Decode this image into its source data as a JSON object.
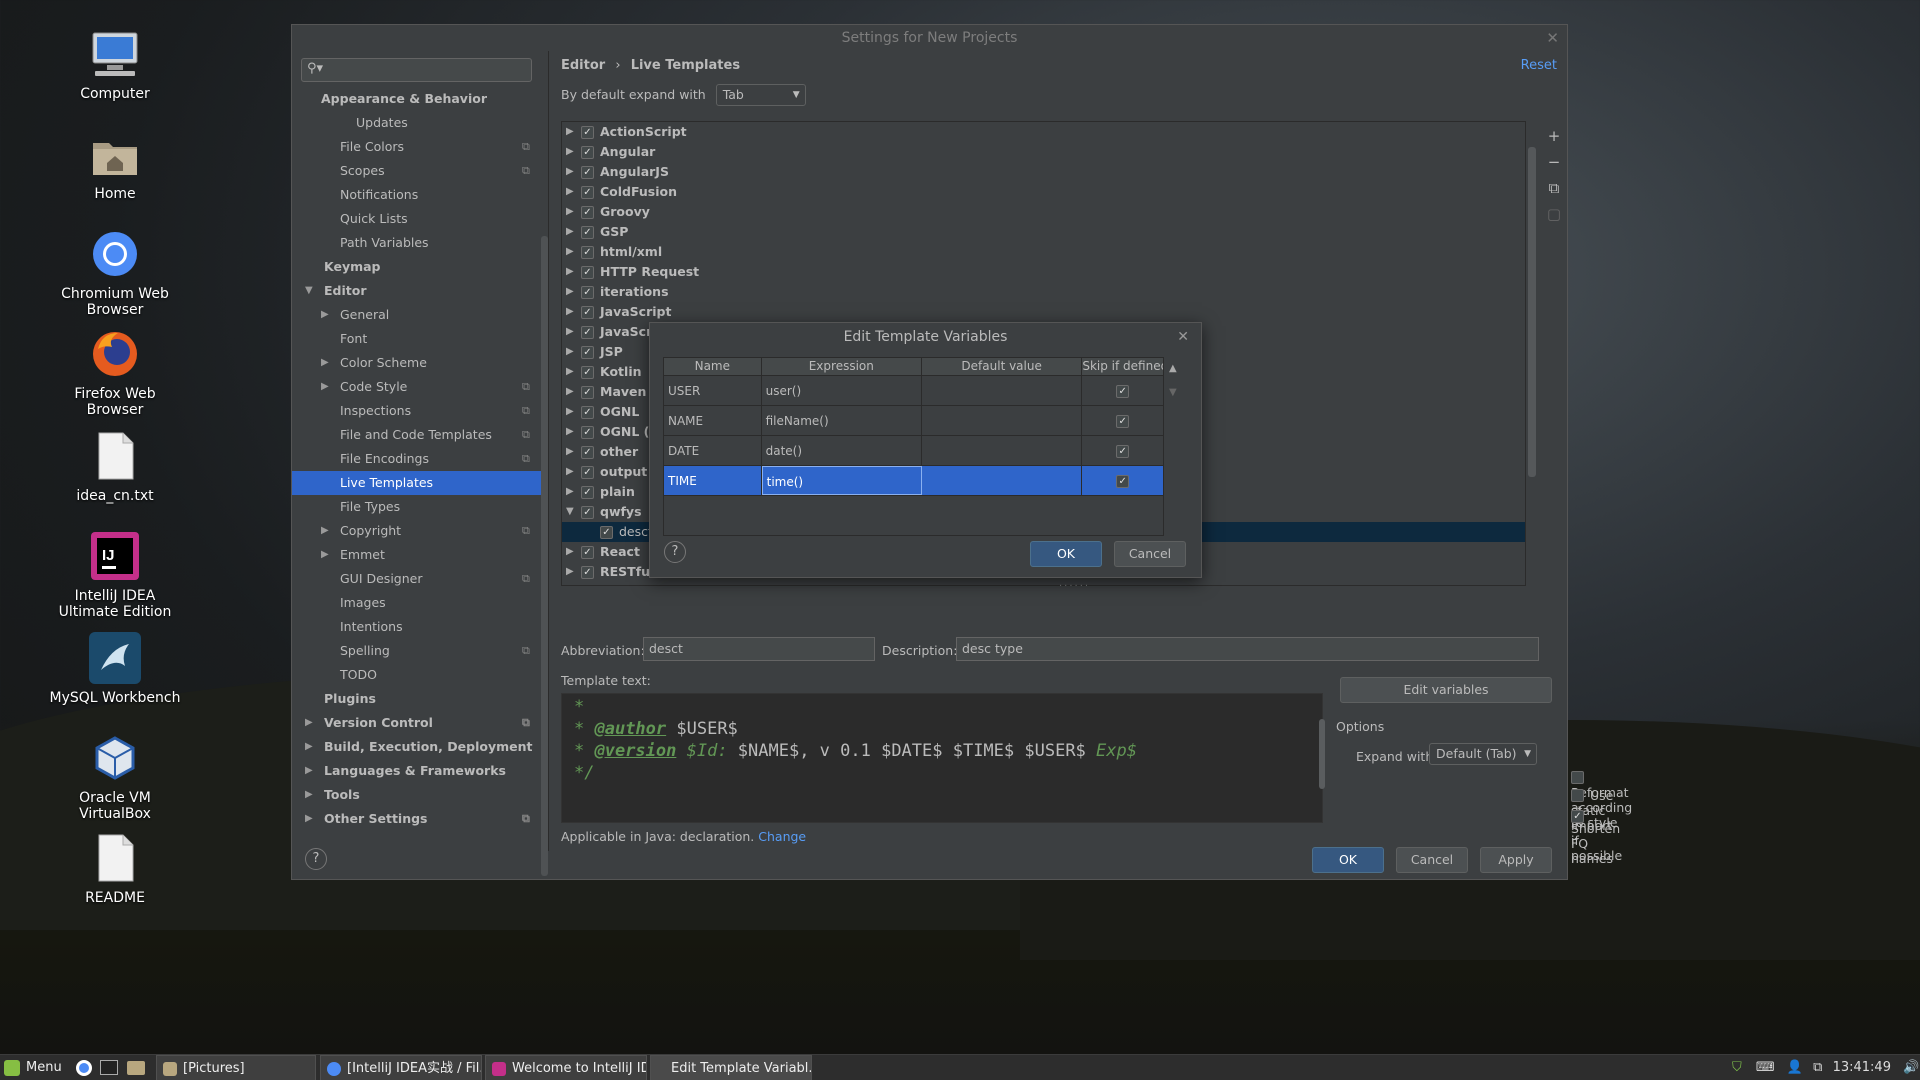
{
  "desktop": {
    "icons": [
      {
        "label": "Computer",
        "icon": "computer-icon"
      },
      {
        "label": "Home",
        "icon": "home-folder-icon"
      },
      {
        "label": "Chromium Web Browser",
        "icon": "chromium-icon"
      },
      {
        "label": "Firefox Web Browser",
        "icon": "firefox-icon"
      },
      {
        "label": "idea_cn.txt",
        "icon": "text-file-icon"
      },
      {
        "label": "IntelliJ IDEA Ultimate Edition",
        "icon": "intellij-icon"
      },
      {
        "label": "MySQL Workbench",
        "icon": "mysql-workbench-icon"
      },
      {
        "label": "Oracle VM VirtualBox",
        "icon": "virtualbox-icon"
      },
      {
        "label": "README",
        "icon": "text-file-icon"
      }
    ]
  },
  "window": {
    "title": "Settings for New Projects",
    "search_placeholder": "Q",
    "sidebar": [
      {
        "label": "Appearance & Behavior",
        "level": 0,
        "bold": true,
        "arrow": "none"
      },
      {
        "label": "Updates",
        "level": 2
      },
      {
        "label": "File Colors",
        "level": 1,
        "copy": true
      },
      {
        "label": "Scopes",
        "level": 1,
        "copy": true
      },
      {
        "label": "Notifications",
        "level": 1
      },
      {
        "label": "Quick Lists",
        "level": 1
      },
      {
        "label": "Path Variables",
        "level": 1
      },
      {
        "label": "Keymap",
        "level": 0,
        "bold": true
      },
      {
        "label": "Editor",
        "level": 0,
        "bold": true,
        "arrow": "down"
      },
      {
        "label": "General",
        "level": 1,
        "arrow": "right"
      },
      {
        "label": "Font",
        "level": 1
      },
      {
        "label": "Color Scheme",
        "level": 1,
        "arrow": "right"
      },
      {
        "label": "Code Style",
        "level": 1,
        "arrow": "right",
        "copy": true
      },
      {
        "label": "Inspections",
        "level": 1,
        "copy": true
      },
      {
        "label": "File and Code Templates",
        "level": 1,
        "copy": true
      },
      {
        "label": "File Encodings",
        "level": 1,
        "copy": true
      },
      {
        "label": "Live Templates",
        "level": 1,
        "selected": true
      },
      {
        "label": "File Types",
        "level": 1
      },
      {
        "label": "Copyright",
        "level": 1,
        "arrow": "right",
        "copy": true
      },
      {
        "label": "Emmet",
        "level": 1,
        "arrow": "right"
      },
      {
        "label": "GUI Designer",
        "level": 1,
        "copy": true
      },
      {
        "label": "Images",
        "level": 1
      },
      {
        "label": "Intentions",
        "level": 1
      },
      {
        "label": "Spelling",
        "level": 1,
        "copy": true
      },
      {
        "label": "TODO",
        "level": 1
      },
      {
        "label": "Plugins",
        "level": 0,
        "bold": true
      },
      {
        "label": "Version Control",
        "level": 0,
        "bold": true,
        "arrow": "right",
        "copy": true
      },
      {
        "label": "Build, Execution, Deployment",
        "level": 0,
        "bold": true,
        "arrow": "right"
      },
      {
        "label": "Languages & Frameworks",
        "level": 0,
        "bold": true,
        "arrow": "right"
      },
      {
        "label": "Tools",
        "level": 0,
        "bold": true,
        "arrow": "right"
      },
      {
        "label": "Other Settings",
        "level": 0,
        "bold": true,
        "arrow": "right",
        "copy": true
      }
    ],
    "breadcrumb": {
      "parent": "Editor",
      "sep": "›",
      "current": "Live Templates"
    },
    "reset_label": "Reset",
    "expand_label": "By default expand with",
    "expand_value": "Tab",
    "template_groups": [
      {
        "label": "ActionScript"
      },
      {
        "label": "Angular"
      },
      {
        "label": "AngularJS"
      },
      {
        "label": "ColdFusion"
      },
      {
        "label": "Groovy"
      },
      {
        "label": "GSP"
      },
      {
        "label": "html/xml"
      },
      {
        "label": "HTTP Request"
      },
      {
        "label": "iterations"
      },
      {
        "label": "JavaScript"
      },
      {
        "label": "JavaScri"
      },
      {
        "label": "JSP"
      },
      {
        "label": "Kotlin"
      },
      {
        "label": "Maven"
      },
      {
        "label": "OGNL"
      },
      {
        "label": "OGNL (S"
      },
      {
        "label": "other"
      },
      {
        "label": "output"
      },
      {
        "label": "plain"
      },
      {
        "label": "qwfys",
        "expanded": true
      },
      {
        "label": "desct",
        "child": true
      },
      {
        "label": "React"
      },
      {
        "label": "RESTful"
      }
    ],
    "side_tools": [
      "+",
      "−",
      "⧉",
      "▢"
    ],
    "abbreviation_label": "Abbreviation:",
    "abbreviation_value": "desct",
    "description_label": "Description:",
    "description_value": "desc type",
    "template_text_label": "Template text:",
    "template_lines": {
      "l1": "*",
      "l2_tag": "@author",
      "l2_var": " $USER$",
      "l3_tag": "@version",
      "l3_rest": " $Id:",
      "l3_vars": " $NAME$, v 0.1 $DATE$ $TIME$ $USER$",
      "l3_end": " Exp$",
      "l4": "*/"
    },
    "edit_variables_label": "Edit variables",
    "options_label": "Options",
    "expand_with_label": "Expand with",
    "expand_with_value": "Default (Tab)",
    "options": [
      {
        "label": "Reformat according to style",
        "checked": false
      },
      {
        "label": "Use static import if possible",
        "checked": false
      },
      {
        "label": "Shorten FQ names",
        "checked": true
      }
    ],
    "applicable_text": "Applicable in Java: declaration.",
    "change_label": "Change",
    "ok_label": "OK",
    "cancel_label": "Cancel",
    "apply_label": "Apply"
  },
  "dialog": {
    "title": "Edit Template Variables",
    "columns": [
      "Name",
      "Expression",
      "Default value",
      "Skip if defined"
    ],
    "rows": [
      {
        "name": "USER",
        "expression": "user()",
        "default": "",
        "skip": true
      },
      {
        "name": "NAME",
        "expression": "fileName()",
        "default": "",
        "skip": true
      },
      {
        "name": "DATE",
        "expression": "date()",
        "default": "",
        "skip": true
      },
      {
        "name": "TIME",
        "expression": "time()",
        "default": "",
        "skip": true,
        "selected": true
      }
    ],
    "ok_label": "OK",
    "cancel_label": "Cancel"
  },
  "taskbar": {
    "menu_label": "Menu",
    "windows": [
      {
        "label": "[Pictures]"
      },
      {
        "label": "[IntelliJ IDEA实战 / Fil..."
      },
      {
        "label": "Welcome to IntelliJ ID..."
      },
      {
        "label": "Edit Template Variabl..."
      }
    ],
    "clock": "13:41:49"
  },
  "colors": {
    "accent": "#2f65ca",
    "link": "#589df6",
    "panel": "#3c3f41"
  }
}
